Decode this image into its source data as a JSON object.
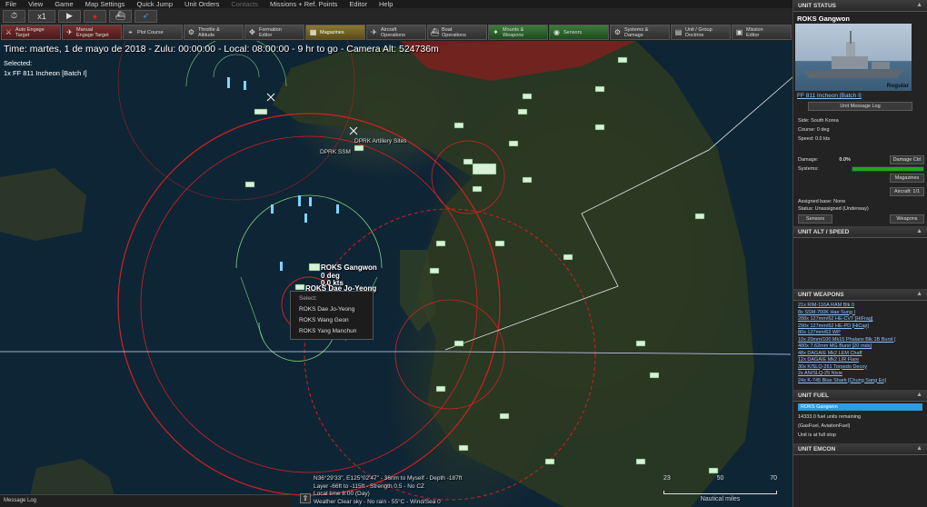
{
  "menu": [
    "File",
    "View",
    "Game",
    "Map Settings",
    "Quick Jump",
    "Unit Orders",
    "Contacts",
    "Missions + Ref. Points",
    "Editor",
    "Help"
  ],
  "menu_dim_index": 6,
  "toolbar1": {
    "speed": "x1",
    "play": "▶",
    "stop": "●"
  },
  "toolbar2": [
    {
      "label": "Auto Engage\nTarget",
      "icon": "⚔",
      "style": "red"
    },
    {
      "label": "Manual\nEngage Target",
      "icon": "✈",
      "style": "red"
    },
    {
      "label": "Plot Course",
      "icon": "⌖",
      "style": ""
    },
    {
      "label": "Throttle &\nAltitude",
      "icon": "⚙",
      "style": ""
    },
    {
      "label": "Formation\nEditor",
      "icon": "✥",
      "style": ""
    },
    {
      "label": "Magazines",
      "icon": "▦",
      "style": "yellow"
    },
    {
      "label": "Aircraft\nOperations",
      "icon": "✈",
      "style": ""
    },
    {
      "label": "Boat\nOperations",
      "icon": "⛴",
      "style": ""
    },
    {
      "label": "Mounts &\nWeapons",
      "icon": "✦",
      "style": "green"
    },
    {
      "label": "Sensors",
      "icon": "◉",
      "style": "green"
    },
    {
      "label": "Systems &\nDamage",
      "icon": "⚙",
      "style": ""
    },
    {
      "label": "Unit / Group\nDoctrine",
      "icon": "▤",
      "style": ""
    },
    {
      "label": "Mission\nEditor",
      "icon": "▣",
      "style": ""
    }
  ],
  "map": {
    "time_line": "Time: martes, 1 de mayo de 2018 - Zulu: 00:00:00 - Local: 08:00:00 - 9 hr to go - Camera Alt: 524736m",
    "selected_label": "Selected:",
    "selected_unit": "1x FF 811 Incheon [Batch I]",
    "labels": {
      "artillery": "DPRK Artillery Sites",
      "ssm": "DPRK SSM",
      "gangwon": "ROKS Gangwon",
      "deg": "0 deg",
      "kts": "0.0 kts",
      "daejo": "ROKS Dae Jo-Yeong"
    },
    "context_menu": {
      "header": "Select:",
      "items": [
        "ROKS Dae Jo-Yeong",
        "ROKS Wang Geon",
        "ROKS Yang Manchun"
      ]
    },
    "status": [
      "N36°29'33\", E125°02'47\" - 36nm to Myself - Depth -187ft",
      "Layer -66ft to -115ft - Strength 0.5 - No CZ",
      "Local time 8:00 (Day)",
      "Weather Clear sky - No rain - 55°C - Wind/Sea 0"
    ],
    "scale": {
      "ticks": [
        "23",
        "50",
        "70"
      ],
      "unit": "Nautical miles"
    },
    "message_log": "Message Log"
  },
  "panel": {
    "status_header": "UNIT STATUS",
    "unit_name": "ROKS Gangwon",
    "proficiency": "Regular",
    "class_link": "FF 811 Incheon [Batch I]",
    "msg_log_btn": "Unit Message Log",
    "side": "Side: South Korea",
    "course": "Course: 0 deg",
    "speed": "Speed: 0.0 kts",
    "damage_label": "Damage:",
    "damage_value": "0.0%",
    "damage_btn": "Damage Ctrl",
    "systems_label": "Systems:",
    "magazines_btn": "Magazines",
    "aircraft_btn": "Aircraft: 1/1",
    "assigned_base": "Assigned base: None",
    "unit_status": "Status: Unassigned (Underway)",
    "sensors_btn": "Sensors",
    "weapons_btn": "Weapons",
    "alt_header": "UNIT ALT / SPEED",
    "weapons_header": "UNIT WEAPONS",
    "weapons": [
      "21x RIM-116A RAM Blk 0",
      "8x SSM-700K Hae Sung I",
      "288x 127mm/62 HE-CVT [HiFrag]",
      "290x 127mm/62 HE-PD [HiCap]",
      "80x 127mm/62 WP",
      "10x 20mm/100 Mk15 Phalanx Blk 1B Burst [",
      "480x 7.62mm MG Burst [20 rnds]",
      "48x DAGAIE Mk2 LEM Chaff",
      "12x DAGAIE Mk2 LIR Flare",
      "30x K/SLQ-261 Torpedo Decoy",
      "2x AN/SLQ-25 Nixie",
      "24x K-745 Blue Shark [Chung Sang Eo]"
    ],
    "fuel_header": "UNIT FUEL",
    "fuel_bar": "ROKS Gangwon",
    "fuel_lines": [
      "14333.0 fuel units remaining",
      "(GasFuel, AviationFuel)",
      "Unit is at full stop"
    ],
    "emcon_header": "UNIT EMCON"
  },
  "colors": {
    "range_ring": "#d42020",
    "friendly": "#7fd4ff",
    "land": "#2c3a22",
    "sea": "#0e2536"
  }
}
